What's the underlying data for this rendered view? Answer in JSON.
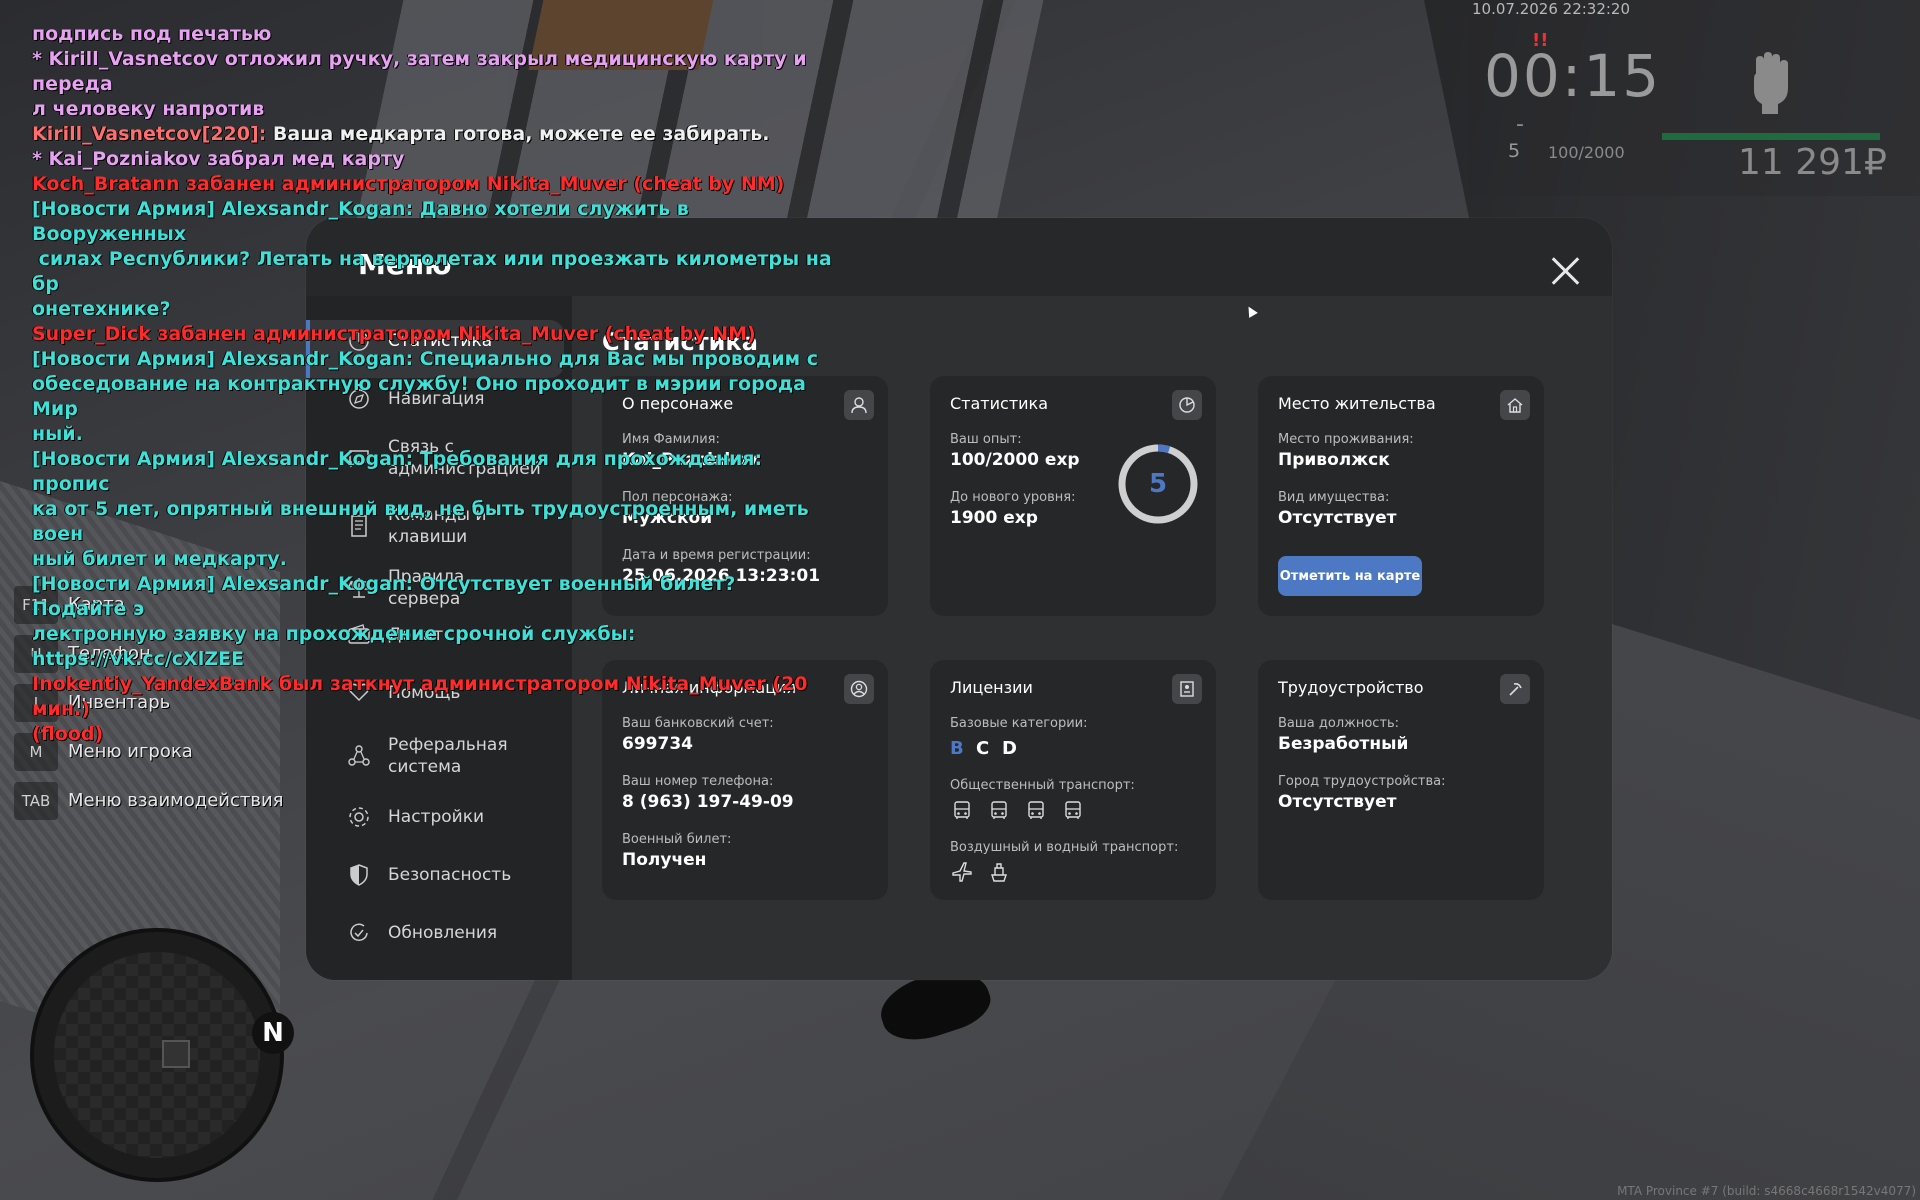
{
  "chat": [
    {
      "parts": [
        {
          "text": "подпись под печатью",
          "color": "pink"
        }
      ]
    },
    {
      "parts": [
        {
          "text": "* Kirill_Vasnetcov отложил ручку, затем закрыл медицинскую карту и переда",
          "color": "pink"
        }
      ]
    },
    {
      "parts": [
        {
          "text": "л человеку напротив",
          "color": "pink"
        }
      ]
    },
    {
      "parts": [
        {
          "text": "Kirill_Vasnetcov[220]: ",
          "color": "salmon"
        },
        {
          "text": "Ваша медкарта готова, можете ее забирать.",
          "color": "white"
        }
      ]
    },
    {
      "parts": [
        {
          "text": "* Kai_Pozniakov забрал мед карту",
          "color": "pink"
        }
      ]
    },
    {
      "parts": [
        {
          "text": "Koch_Bratann забанен администратором Nikita_Muver (cheat by NM)",
          "color": "red"
        }
      ]
    },
    {
      "parts": [
        {
          "text": "[Новости Армия] Alexsandr_Kogan: Давно хотели служить в Вооруженных",
          "color": "cyan"
        }
      ]
    },
    {
      "parts": [
        {
          "text": " силах Республики? Летать на вертолетах или проезжать километры на бр",
          "color": "cyan"
        }
      ]
    },
    {
      "parts": [
        {
          "text": "онетехнике?",
          "color": "cyan"
        }
      ]
    },
    {
      "parts": [
        {
          "text": "Super_Dick забанен администратором Nikita_Muver (cheat by NM)",
          "color": "red"
        }
      ]
    },
    {
      "parts": [
        {
          "text": "[Новости Армия] Alexsandr_Kogan: Специально для Вас мы проводим с",
          "color": "cyan"
        }
      ]
    },
    {
      "parts": [
        {
          "text": "обеседование на контрактную службу! Оно проходит в мэрии города Мир",
          "color": "cyan"
        }
      ]
    },
    {
      "parts": [
        {
          "text": "ный.",
          "color": "cyan"
        }
      ]
    },
    {
      "parts": [
        {
          "text": "[Новости Армия] Alexsandr_Kogan: Требования для прохождения: пропис",
          "color": "cyan"
        }
      ]
    },
    {
      "parts": [
        {
          "text": "ка от 5 лет, опрятный внешний вид, не быть трудоустроенным, иметь воен",
          "color": "cyan"
        }
      ]
    },
    {
      "parts": [
        {
          "text": "ный билет и медкарту.",
          "color": "cyan"
        }
      ]
    },
    {
      "parts": [
        {
          "text": "[Новости Армия] Alexsandr_Kogan: Отсутствует военный билет? Подайте э",
          "color": "cyan"
        }
      ]
    },
    {
      "parts": [
        {
          "text": "лектронную заявку на прохождение срочной службы: https://vk.cc/cXlZEE",
          "color": "cyan"
        }
      ]
    },
    {
      "parts": [
        {
          "text": "Inokentiy_YandexBank был заткнут администратором Nikita_Muver (20 мин.)",
          "color": "red"
        }
      ]
    },
    {
      "parts": [
        {
          "text": "(flood)",
          "color": "red"
        }
      ]
    }
  ],
  "hud": {
    "datetime": "10.07.2026 22:32:20",
    "wanted": "!!",
    "time": "00:15",
    "dash": "-",
    "level": "5",
    "exp": "100/2000",
    "money": "11 291₽",
    "fist_icon": "fist-icon"
  },
  "keys": [
    {
      "key": "F11",
      "label": "Карта"
    },
    {
      "key": "U",
      "label": "Телефон"
    },
    {
      "key": "I",
      "label": "Инвентарь"
    },
    {
      "key": "M",
      "label": "Меню игрока"
    },
    {
      "key": "TAB",
      "label": "Меню взаимодействия"
    }
  ],
  "compass": "N",
  "build": "MTA Province #7 (build: s4668c4668r1542v4077)",
  "menu": {
    "title": "Меню",
    "nav": [
      {
        "label": "Статистика",
        "icon": "chart-pie-icon",
        "active": true
      },
      {
        "label": "Навигация",
        "icon": "compass-icon"
      },
      {
        "label": "Связь с администрацией",
        "icon": "chat-icon"
      },
      {
        "label": "Команды и клавиши",
        "icon": "document-icon"
      },
      {
        "label": "Правила сервера",
        "icon": "scales-icon"
      },
      {
        "label": "Донат",
        "icon": "wallet-icon"
      },
      {
        "label": "Помощь",
        "icon": "heart-hand-icon"
      },
      {
        "label": "Реферальная система",
        "icon": "network-icon"
      },
      {
        "label": "Настройки",
        "icon": "gear-icon"
      },
      {
        "label": "Безопасность",
        "icon": "shield-icon"
      },
      {
        "label": "Обновления",
        "icon": "refresh-check-icon"
      }
    ],
    "content_title": "Статистика",
    "cards": {
      "about": {
        "title": "О персонаже",
        "name_label": "Имя Фамилия:",
        "name_value": "Kai_Pozniakov",
        "gender_label": "Пол персонажа:",
        "gender_value": "Мужской",
        "reg_label": "Дата и время регистрации:",
        "reg_value": "25.06.2026 13:23:01"
      },
      "stats": {
        "title": "Статистика",
        "exp_label": "Ваш опыт:",
        "exp_value": "100/2000 exp",
        "next_label": "До нового уровня:",
        "next_value": "1900 exp",
        "level": "5",
        "progress": 0.05
      },
      "residence": {
        "title": "Место жительства",
        "place_label": "Место проживания:",
        "place_value": "Приволжск",
        "property_label": "Вид имущества:",
        "property_value": "Отсутствует",
        "button": "Отметить на карте"
      },
      "personal": {
        "title": "Личная информация",
        "bank_label": "Ваш банковский счет:",
        "bank_value": "699734",
        "phone_label": "Ваш номер телефона:",
        "phone_value": "8 (963) 197-49-09",
        "military_label": "Военный билет:",
        "military_value": "Получен"
      },
      "licenses": {
        "title": "Лицензии",
        "base_label": "Базовые категории:",
        "categories": [
          {
            "text": "B",
            "active": true
          },
          {
            "text": "C",
            "active": false
          },
          {
            "text": "D",
            "active": false
          }
        ],
        "public_label": "Общественный транспорт:",
        "public_icons": [
          "bus-icon",
          "trolleybus-icon",
          "tram-icon",
          "taxi-icon"
        ],
        "airwater_label": "Воздушный и водный транспорт:",
        "airwater_icons": [
          "plane-icon",
          "boat-icon"
        ]
      },
      "job": {
        "title": "Трудоустройство",
        "position_label": "Ваша должность:",
        "position_value": "Безработный",
        "city_label": "Город трудоустройства:",
        "city_value": "Отсутствует"
      }
    },
    "colors": {
      "accent": "#4d79c4",
      "panel": "#272829",
      "content": "#2f3032",
      "card": "#262728"
    }
  }
}
